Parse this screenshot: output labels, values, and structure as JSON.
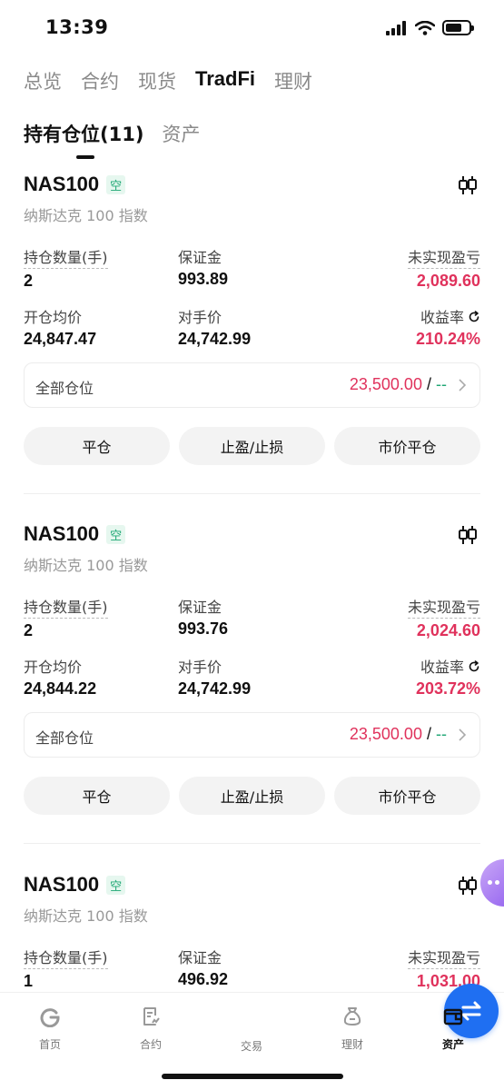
{
  "status": {
    "time": "13:39"
  },
  "category_tabs": [
    "总览",
    "合约",
    "现货",
    "TradFi",
    "理财"
  ],
  "sub_tabs": {
    "holdings": "持有仓位(11)",
    "assets": "资产"
  },
  "labels": {
    "qty": "持仓数量(手)",
    "margin": "保证金",
    "upnl": "未实现盈亏",
    "entry": "开仓均价",
    "counter": "对手价",
    "roi": "收益率",
    "all_positions": "全部仓位",
    "close": "平仓",
    "tp_sl": "止盈/止损",
    "market_close": "市价平仓"
  },
  "positions": [
    {
      "symbol": "NAS100",
      "side": "空",
      "name": "纳斯达克 100 指数",
      "qty": "2",
      "margin": "993.89",
      "upnl": "2,089.60",
      "entry": "24,847.47",
      "counter": "24,742.99",
      "roi": "210.24%",
      "tp": "23,500.00",
      "sl": "--"
    },
    {
      "symbol": "NAS100",
      "side": "空",
      "name": "纳斯达克 100 指数",
      "qty": "2",
      "margin": "993.76",
      "upnl": "2,024.60",
      "entry": "24,844.22",
      "counter": "24,742.99",
      "roi": "203.72%",
      "tp": "23,500.00",
      "sl": "--"
    },
    {
      "symbol": "NAS100",
      "side": "空",
      "name": "纳斯达克 100 指数",
      "qty": "1",
      "margin": "496.92",
      "upnl": "1,031.00"
    }
  ],
  "tabbar": {
    "home": "首页",
    "contracts": "合约",
    "trade": "交易",
    "finance": "理财",
    "assets": "资产"
  },
  "colors": {
    "profit": "#e0325c",
    "short_badge": "#1fa774",
    "accent": "#1f6ff2"
  }
}
